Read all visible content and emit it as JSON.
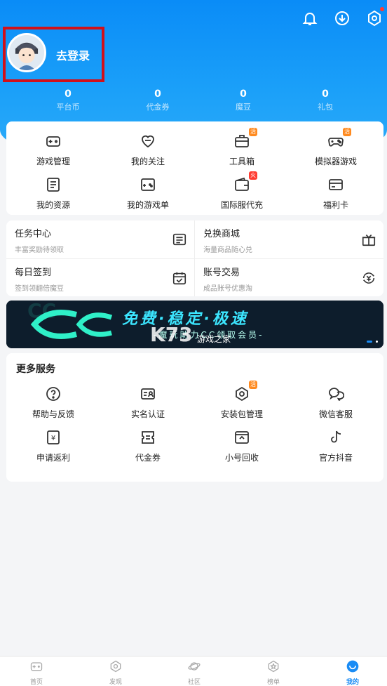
{
  "header": {
    "login_label": "去登录",
    "icons": [
      "bell-icon",
      "download-icon",
      "settings-icon"
    ],
    "stats": [
      {
        "value": "0",
        "label": "平台币"
      },
      {
        "value": "0",
        "label": "代金券"
      },
      {
        "value": "0",
        "label": "魔豆"
      },
      {
        "value": "0",
        "label": "礼包"
      }
    ]
  },
  "tools": [
    {
      "label": "游戏管理",
      "icon": "gamepad-icon"
    },
    {
      "label": "我的关注",
      "icon": "heart-icon"
    },
    {
      "label": "工具箱",
      "icon": "toolbox-icon",
      "badge": "活"
    },
    {
      "label": "模拟器游戏",
      "icon": "controller-icon",
      "badge": "活"
    },
    {
      "label": "我的资源",
      "icon": "resource-icon"
    },
    {
      "label": "我的游戏单",
      "icon": "game-list-icon"
    },
    {
      "label": "国际服代充",
      "icon": "wallet-icon",
      "badge": "火"
    },
    {
      "label": "福利卡",
      "icon": "card-icon"
    }
  ],
  "tasks": [
    {
      "title": "任务中心",
      "sub": "丰富奖励待领取",
      "icon": "task-icon"
    },
    {
      "title": "兑换商城",
      "sub": "海量商品随心兑",
      "icon": "gift-icon"
    },
    {
      "title": "每日签到",
      "sub": "签到领翻倍魔豆",
      "icon": "calendar-icon"
    },
    {
      "title": "账号交易",
      "sub": "成品账号优惠淘",
      "icon": "exchange-icon"
    }
  ],
  "banner": {
    "headline": "免费·稳定·极速",
    "subline": "-魔玩助力CC领取会员-",
    "watermark": "K73",
    "watermark_sub": "游戏之家"
  },
  "services": {
    "title": "更多服务",
    "items": [
      {
        "label": "帮助与反馈",
        "icon": "help-icon"
      },
      {
        "label": "实名认证",
        "icon": "id-card-icon"
      },
      {
        "label": "安装包管理",
        "icon": "package-icon",
        "badge": "活"
      },
      {
        "label": "微信客服",
        "icon": "wechat-icon"
      },
      {
        "label": "申请返利",
        "icon": "rebate-icon"
      },
      {
        "label": "代金券",
        "icon": "coupon-icon"
      },
      {
        "label": "小号回收",
        "icon": "recycle-icon"
      },
      {
        "label": "官方抖音",
        "icon": "tiktok-icon"
      }
    ]
  },
  "tabbar": [
    {
      "label": "首页",
      "icon": "home-icon"
    },
    {
      "label": "发现",
      "icon": "discover-icon"
    },
    {
      "label": "社区",
      "icon": "community-icon"
    },
    {
      "label": "榜单",
      "icon": "ranking-icon"
    },
    {
      "label": "我的",
      "icon": "profile-icon",
      "active": true
    }
  ],
  "colors": {
    "accent": "#0a8cf7",
    "badge_orange": "#ff8a1f",
    "badge_red": "#ff3b30",
    "active_tab": "#1a8cf5"
  }
}
